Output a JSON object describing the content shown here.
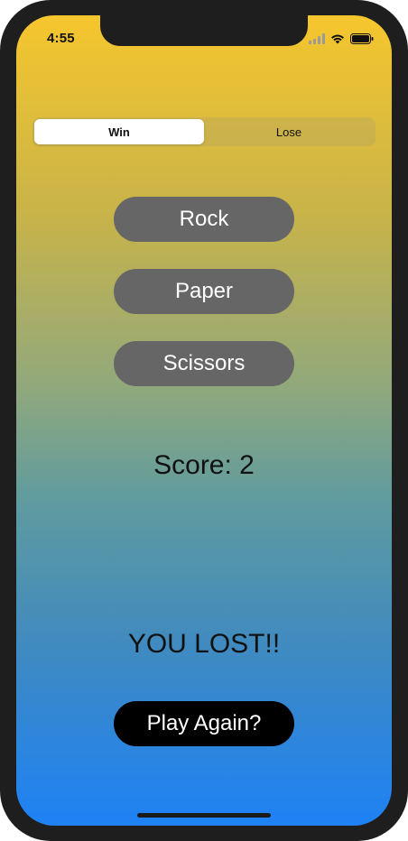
{
  "status_bar": {
    "time": "4:55",
    "icons": [
      "signal-icon",
      "wifi-icon",
      "battery-icon"
    ]
  },
  "mode_selector": {
    "options": [
      "Win",
      "Lose"
    ],
    "selected": "Win"
  },
  "choices": {
    "rock": "Rock",
    "paper": "Paper",
    "scissors": "Scissors"
  },
  "score_text": "Score: 2",
  "result_text": "YOU LOST!!",
  "play_again_label": "Play Again?",
  "colors": {
    "gradient_top": "#f6c62d",
    "gradient_bottom": "#1e82f5",
    "choice_button": "#666666",
    "play_again_button": "#000000"
  }
}
